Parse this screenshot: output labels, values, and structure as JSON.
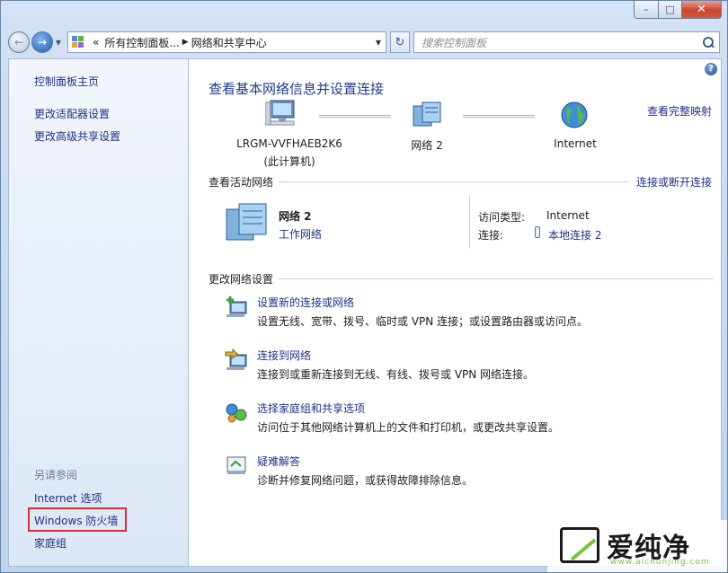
{
  "window": {
    "minimize": "–",
    "maximize": "□",
    "close": "✕"
  },
  "toolbar": {
    "back": "←",
    "forward": "→",
    "refresh": "↻",
    "breadcrumb": [
      "«",
      "所有控制面板...",
      "网络和共享中心"
    ],
    "search_placeholder": "搜索控制面板"
  },
  "sidebar": {
    "items": [
      "控制面板主页",
      "更改适配器设置",
      "更改高级共享设置"
    ],
    "see_also_label": "另请参阅",
    "see_also": [
      "Internet 选项",
      "Windows 防火墙",
      "家庭组"
    ]
  },
  "main": {
    "title": "查看基本网络信息并设置连接",
    "full_map_link": "查看完整映射",
    "map": {
      "computer_name": "LRGM-VVFHAEB2K6",
      "computer_sub": "(此计算机)",
      "network": "网络  2",
      "internet": "Internet"
    },
    "active_section": "查看活动网络",
    "connect_disconnect_link": "连接或断开连接",
    "active_network": {
      "name": "网络  2",
      "type": "工作网络",
      "access_label": "访问类型:",
      "access_value": "Internet",
      "connection_label": "连接:",
      "connection_value": "本地连接 2"
    },
    "change_section": "更改网络设置",
    "tasks": [
      {
        "title": "设置新的连接或网络",
        "desc": "设置无线、宽带、拨号、临时或 VPN 连接；或设置路由器或访问点。"
      },
      {
        "title": "连接到网络",
        "desc": "连接到或重新连接到无线、有线、拨号或 VPN 网络连接。"
      },
      {
        "title": "选择家庭组和共享选项",
        "desc": "访问位于其他网络计算机上的文件和打印机，或更改共享设置。"
      },
      {
        "title": "疑难解答",
        "desc": "诊断并修复网络问题，或获得故障排除信息。"
      }
    ]
  },
  "watermark": {
    "brand": "爱纯净",
    "url": "www.aichunjing.com"
  },
  "colors": {
    "link": "#1e3287",
    "title": "#1e3c8c",
    "highlight_box": "#d63131"
  }
}
